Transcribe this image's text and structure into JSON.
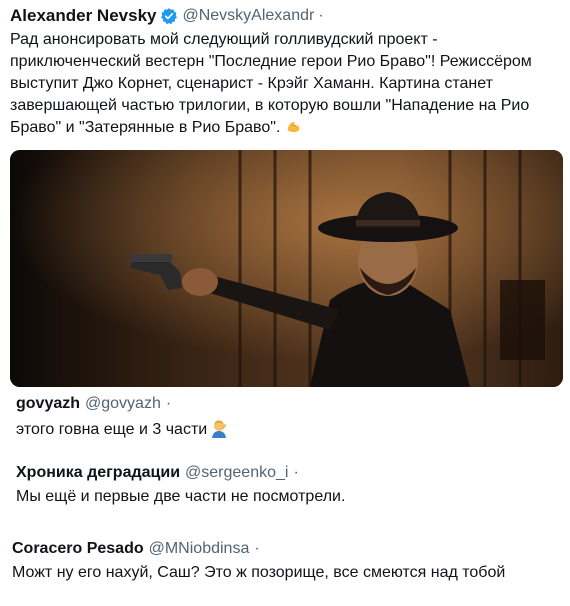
{
  "post": {
    "author_name": "Alexander Nevsky",
    "handle": "@NevskyAlexandr",
    "separator": "·",
    "text": "Рад анонсировать мой следующий голливудский проект - приключенческий вестерн \"Последние герои Рио Браво\"! Режиссёром выступит Джо Корнет, сценарист - Крэйг Хаманн. Картина станет завершающей частью трилогии, в которую вошли \"Нападение на Рио Браво\" и \"Затерянные в Рио Браво\".",
    "emoji_icon": "flexed-biceps-icon",
    "verified_icon": "verified-badge-icon",
    "accent_color": "#1d9bf0"
  },
  "replies": [
    {
      "name": "govyazh",
      "handle": "@govyazh",
      "separator": "·",
      "text": "этого говна еще и 3 части",
      "emoji_icon": "person-facepalming-icon"
    },
    {
      "name": "Хроника деградации",
      "handle": "@sergeenko_i",
      "separator": "·",
      "text": "Мы ещё и первые две части не посмотрели."
    },
    {
      "name": "Coracero Pesado",
      "handle": "@MNiobdinsa",
      "separator": "·",
      "text": "Можт ну его нахуй, Саш? Это ж позорище, все смеются над тобой"
    }
  ]
}
